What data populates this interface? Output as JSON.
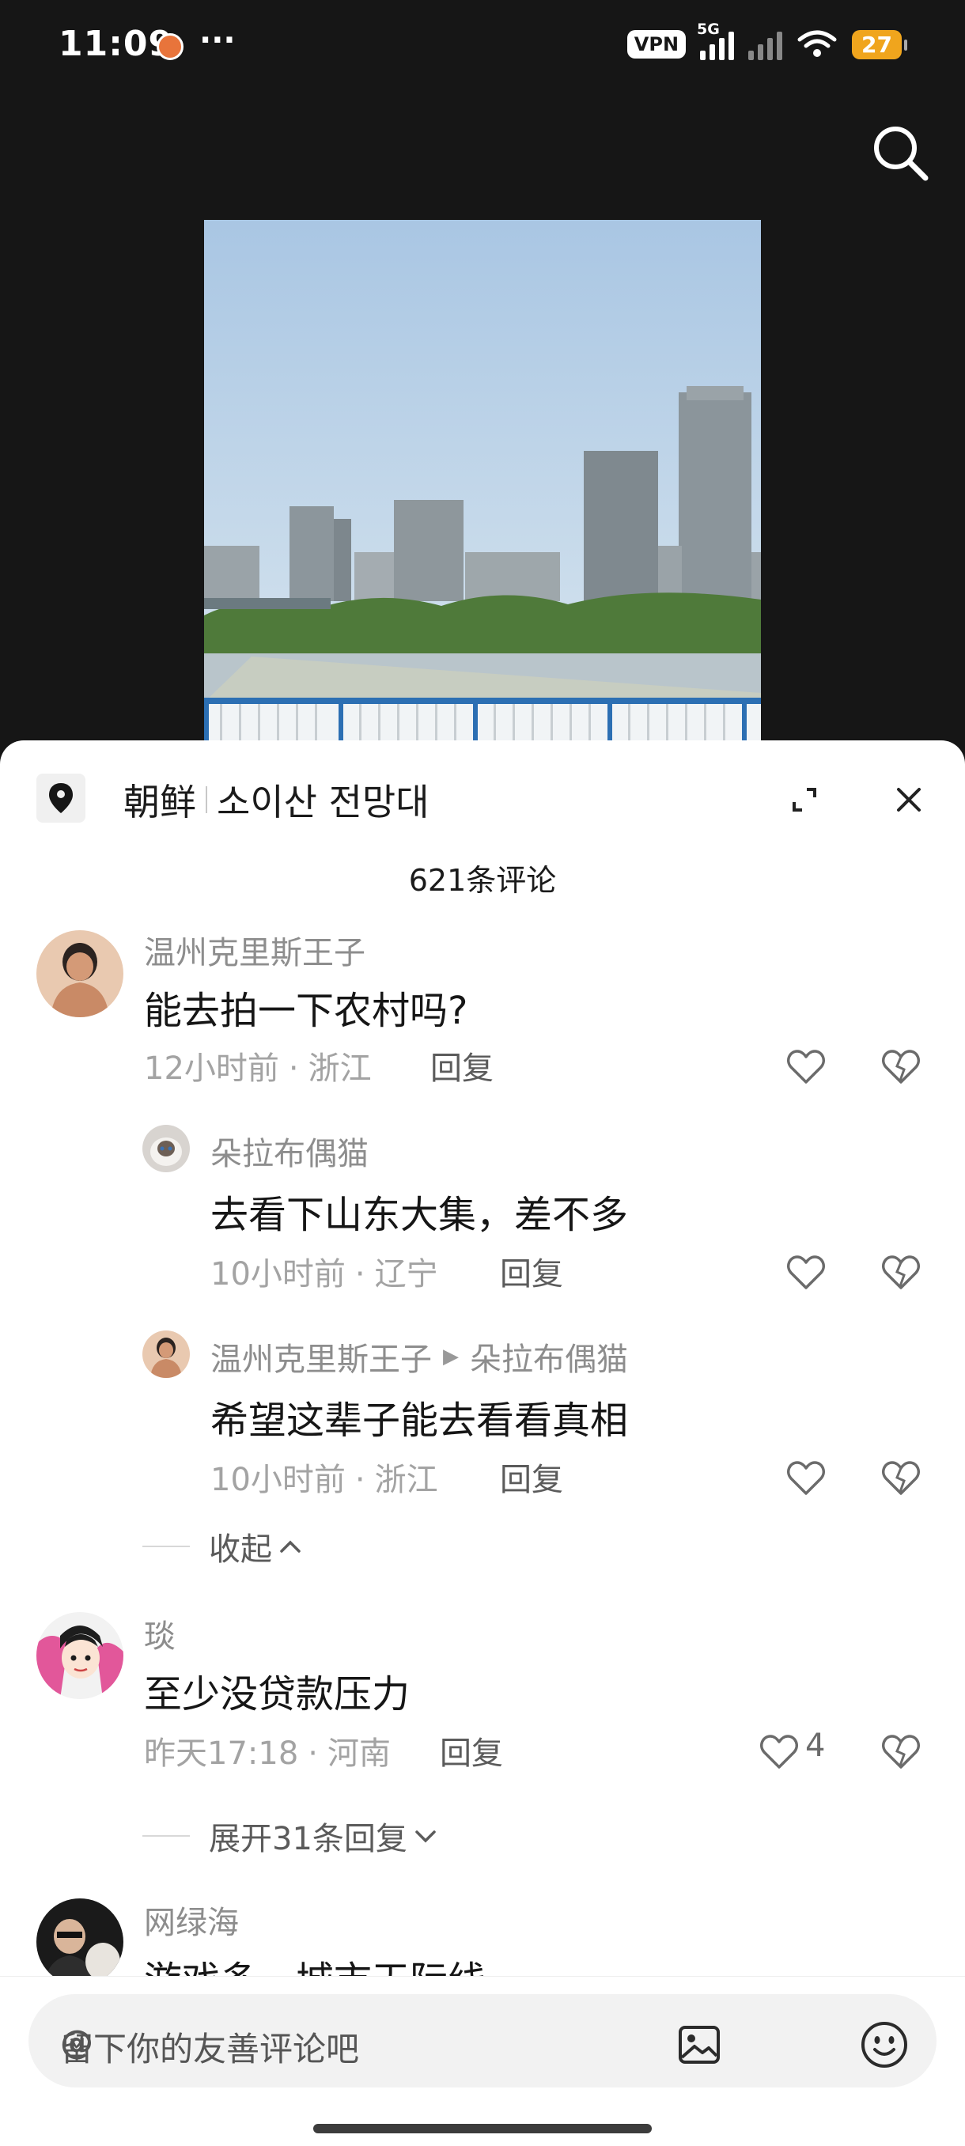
{
  "status_bar": {
    "time": "11:09",
    "dots": "···",
    "vpn": "VPN",
    "network": "5G",
    "battery": "27"
  },
  "location": {
    "name_cn": "朝鲜",
    "name_kr": "소이산 전망대"
  },
  "comment_count": "621条评论",
  "comments": [
    {
      "user": "温州克里斯王子",
      "text": "能去拍一下农村吗?",
      "time": "12小时前",
      "region": "浙江",
      "reply_label": "回复",
      "replies": [
        {
          "user": "朵拉布偶猫",
          "text": "去看下山东大集，差不多",
          "time": "10小时前",
          "region": "辽宁",
          "reply_label": "回复"
        },
        {
          "user": "温州克里斯王子",
          "reply_to": "朵拉布偶猫",
          "text": "希望这辈子能去看看真相",
          "time": "10小时前",
          "region": "浙江",
          "reply_label": "回复"
        }
      ],
      "collapse_label": "收起"
    },
    {
      "user": "琰",
      "text": "至少没贷款压力",
      "time": "昨天17:18",
      "region": "河南",
      "reply_label": "回复",
      "likes": "4",
      "expand_label": "展开31条回复"
    },
    {
      "user": "网绿海",
      "text": "游戏多，城市天际线"
    }
  ],
  "input": {
    "placeholder": "留下你的友善评论吧"
  },
  "colors": {
    "background_top": "#161616",
    "sheet": "#ffffff",
    "battery": "#f0a51d"
  }
}
